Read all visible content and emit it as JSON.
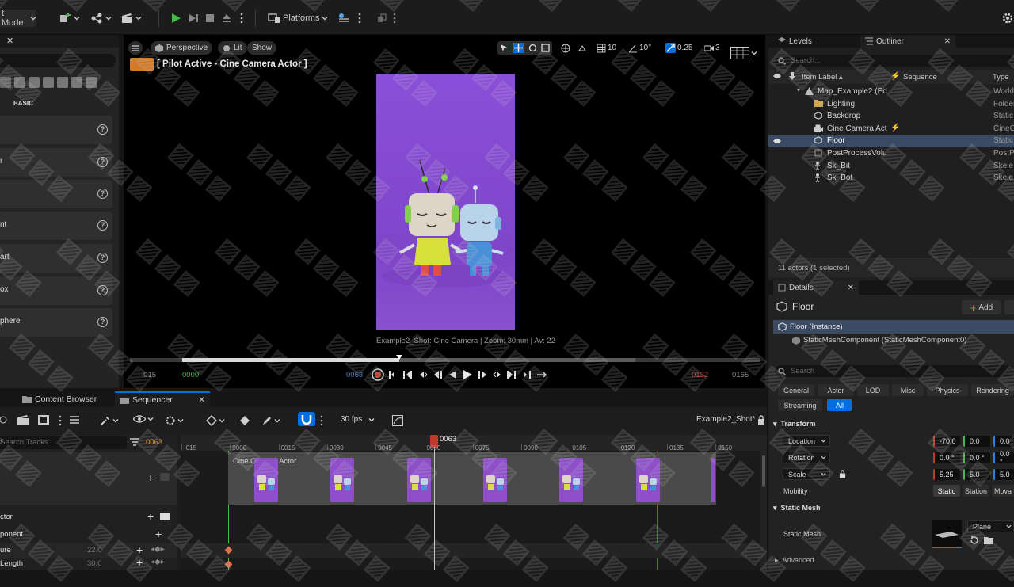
{
  "toolbar": {
    "mode_label": "t Mode",
    "platforms_label": "Platforms"
  },
  "left_panel": {
    "section_label": "BASIC",
    "items": [
      {
        "label": ""
      },
      {
        "label": "r"
      },
      {
        "label": ""
      },
      {
        "label": "nt"
      },
      {
        "label": "art"
      },
      {
        "label": "ox"
      },
      {
        "label": "phere"
      }
    ]
  },
  "viewport": {
    "perspective_label": "Perspective",
    "lit_label": "Lit",
    "show_label": "Show",
    "pilot_label": "[ Pilot Active - Cine Camera Actor ]",
    "grid_value": "10",
    "angle_value": "10°",
    "scale_value": "0.25",
    "camera_speed": "3",
    "camera_info": "Example2_Shot: Cine Camera | Zoom: 30mm | Av: 22"
  },
  "playback": {
    "range_start": "-015",
    "play_start": "0000",
    "current_frame": "0063",
    "play_end": "0132",
    "range_end": "0165",
    "progress": 0.427,
    "end_progress": 0.802
  },
  "sequencer": {
    "tabs": {
      "content_browser": "Content Browser",
      "sequencer": "Sequencer"
    },
    "fps_label": "30 fps",
    "sequence_name": "Example2_Shot*",
    "search_placeholder": "Search Tracks",
    "current_frame": "0063",
    "ticks": [
      "-015",
      "0000",
      "0015",
      "0030",
      "0045",
      "0060",
      "0075",
      "0090",
      "0105",
      "0120",
      "0135",
      "0150"
    ],
    "clip_label": "Cine Camera Actor",
    "tracks": [
      {
        "label": "ctor",
        "value": ""
      },
      {
        "label": "ponent",
        "value": ""
      },
      {
        "label": "ure",
        "value": "22.0"
      },
      {
        "label": "Length",
        "value": "30.0"
      }
    ]
  },
  "outliner": {
    "tabs": {
      "levels": "Levels",
      "outliner": "Outliner"
    },
    "search_placeholder": "Search...",
    "columns": {
      "label": "Item Label ▴",
      "sequence": "Sequence",
      "type": "Type"
    },
    "rows": [
      {
        "label": "Map_Example2 (Ed",
        "type": "World",
        "indent": 1,
        "icon": "map-icon"
      },
      {
        "label": "Lighting",
        "type": "Folder",
        "indent": 2,
        "icon": "folder-icon"
      },
      {
        "label": "Backdrop",
        "type": "Static",
        "indent": 2,
        "icon": "mesh-icon"
      },
      {
        "label": "Cine Camera Act",
        "type": "CineC",
        "indent": 2,
        "icon": "camera-icon",
        "sequence": "⚡"
      },
      {
        "label": "Floor",
        "type": "Static",
        "indent": 2,
        "icon": "mesh-icon",
        "selected": true
      },
      {
        "label": "PostProcessVolu",
        "type": "PostP",
        "indent": 2,
        "icon": "volume-icon"
      },
      {
        "label": "Sk_Bit",
        "type": "Skele",
        "indent": 2,
        "icon": "skeleton-icon"
      },
      {
        "label": "Sk_Bot",
        "type": "Skele",
        "indent": 2,
        "icon": "skeleton-icon"
      }
    ],
    "status": "11 actors (1 selected)"
  },
  "details": {
    "tab_label": "Details",
    "actor_name": "Floor",
    "add_label": "Add",
    "instance_label": "Floor (Instance)",
    "component_label": "StaticMeshComponent (StaticMeshComponent0)",
    "search_placeholder": "Search",
    "categories": [
      "General",
      "Actor",
      "LOD",
      "Misc",
      "Physics",
      "Rendering"
    ],
    "categories2": [
      "Streaming",
      "All"
    ],
    "transform_label": "Transform",
    "location_label": "Location",
    "rotation_label": "Rotation",
    "scale_label": "Scale",
    "location": [
      "-70.0",
      "0.0",
      "0.0"
    ],
    "rotation": [
      "0.0 °",
      "0.0 °",
      "0.0 °"
    ],
    "scale": [
      "5.25",
      "5.0",
      "5.0"
    ],
    "mobility_label": "Mobility",
    "mobility_options": [
      "Static",
      "Station",
      "Mova"
    ],
    "static_mesh_section": "Static Mesh",
    "static_mesh_label": "Static Mesh",
    "mesh_value": "Plane",
    "advanced_label": "Advanced"
  },
  "colors": {
    "accent_blue": "#0070e0",
    "playhead": "#c0392b",
    "clip_purple": "#8e4fc9",
    "play_green": "#3fbf3f"
  }
}
